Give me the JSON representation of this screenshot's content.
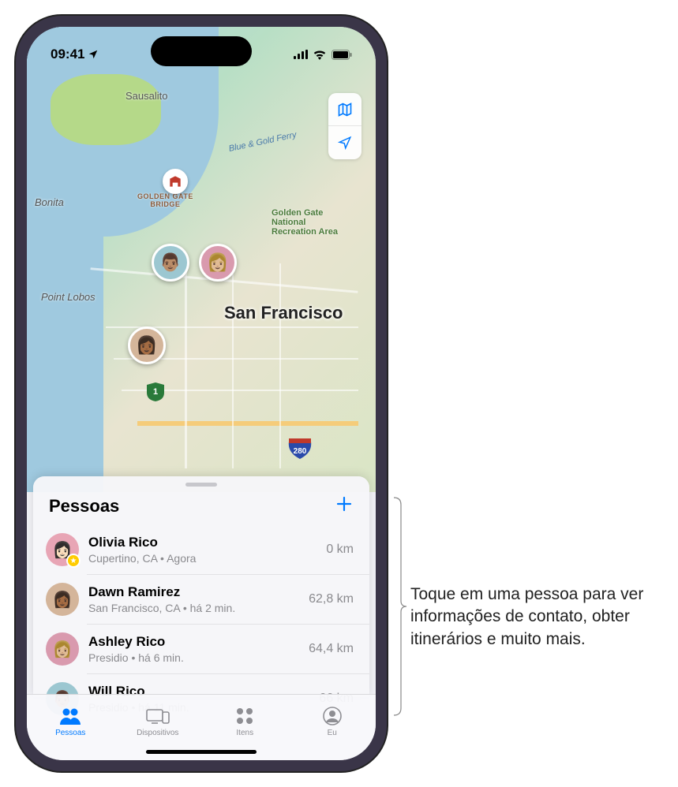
{
  "status": {
    "time": "09:41",
    "location_arrow": "↗"
  },
  "map": {
    "labels": {
      "sausalito": "Sausalito",
      "bonita": "Bonita",
      "point_lobos": "Point Lobos",
      "bridge": "GOLDEN GATE\nBRIDGE",
      "park": "Golden Gate\nNational\nRecreation Area",
      "ferry": "Blue & Gold Ferry",
      "city": "San Francisco",
      "hwy1": "1",
      "hwy280": "280"
    }
  },
  "sheet": {
    "title": "Pessoas"
  },
  "people": [
    {
      "name": "Olivia Rico",
      "sub": "Cupertino, CA • Agora",
      "distance": "0 km",
      "avatar_bg": "#e8a5b5",
      "favorite": true
    },
    {
      "name": "Dawn Ramirez",
      "sub": "San Francisco, CA • há 2 min.",
      "distance": "62,8 km",
      "avatar_bg": "#d4b59a",
      "favorite": false
    },
    {
      "name": "Ashley Rico",
      "sub": "Presidio • há 6 min.",
      "distance": "64,4 km",
      "avatar_bg": "#d99aae",
      "favorite": false
    },
    {
      "name": "Will Rico",
      "sub": "Presidio • há 11 min.",
      "distance": "66 km",
      "avatar_bg": "#9cc7d1",
      "favorite": false
    }
  ],
  "tabs": [
    {
      "label": "Pessoas",
      "active": true
    },
    {
      "label": "Dispositivos",
      "active": false
    },
    {
      "label": "Itens",
      "active": false
    },
    {
      "label": "Eu",
      "active": false
    }
  ],
  "annotation": "Toque em uma pessoa para ver informações de contato, obter itinerários e muito mais."
}
